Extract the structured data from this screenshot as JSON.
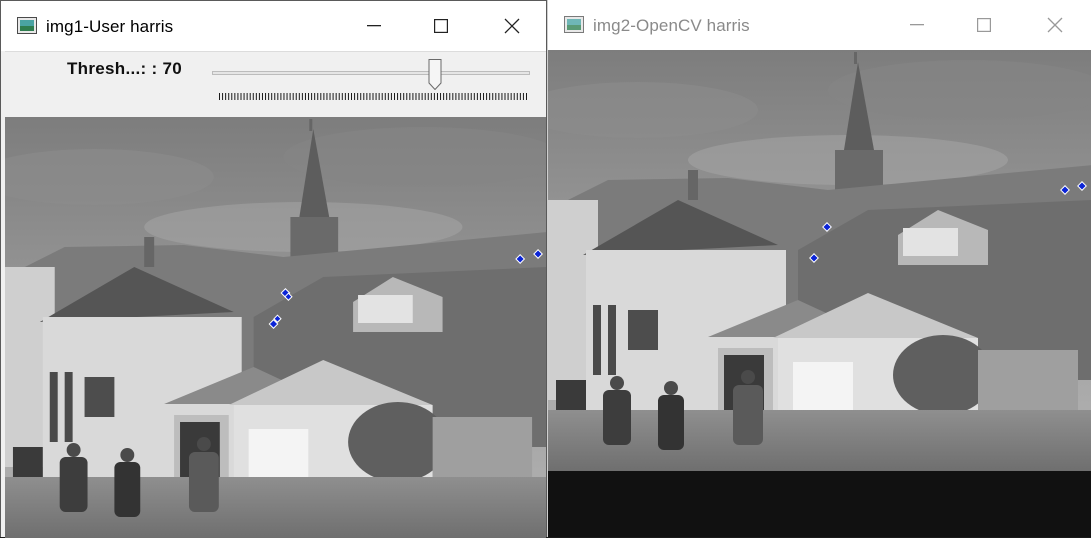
{
  "windows": [
    {
      "title": "img1-User harris",
      "active": true,
      "trackbar": {
        "label": "Thresh...: : 70",
        "value": 70,
        "position_fraction": 0.7
      }
    },
    {
      "title": "img2-OpenCV harris",
      "active": false
    }
  ],
  "controls": {
    "minimize": "minimize-icon",
    "maximize": "maximize-icon",
    "close": "close-icon"
  },
  "colors": {
    "corner_marker": "#0a23d6",
    "titlebar": "#ffffff",
    "inactive_title": "#8a8a8a"
  }
}
